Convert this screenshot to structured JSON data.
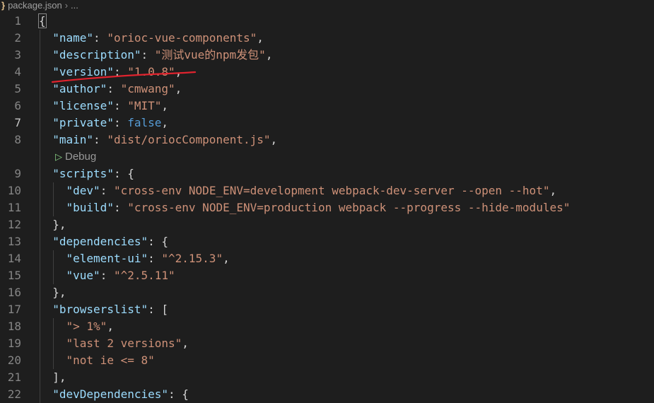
{
  "breadcrumb": {
    "file_icon": "}",
    "file": "package.json",
    "separator": "›",
    "more": "..."
  },
  "codelens": {
    "label": "Debug"
  },
  "colors": {
    "key": "#9cdcfe",
    "string": "#ce9178",
    "keyword": "#569cd6",
    "annotation": "#e0232e"
  },
  "icons": [
    "json-file-icon",
    "play-icon"
  ],
  "lines": [
    {
      "n": "1",
      "indent": 0,
      "tokens": [
        [
          "p",
          "{"
        ]
      ]
    },
    {
      "n": "2",
      "indent": 1,
      "tokens": [
        [
          "k",
          "\"name\""
        ],
        [
          "p",
          ": "
        ],
        [
          "s",
          "\"orioc-vue-components\""
        ],
        [
          "p",
          ","
        ]
      ]
    },
    {
      "n": "3",
      "indent": 1,
      "tokens": [
        [
          "k",
          "\"description\""
        ],
        [
          "p",
          ": "
        ],
        [
          "s",
          "\"测试vue的npm发包\""
        ],
        [
          "p",
          ","
        ]
      ]
    },
    {
      "n": "4",
      "indent": 1,
      "tokens": [
        [
          "k",
          "\"version\""
        ],
        [
          "p",
          ": "
        ],
        [
          "s",
          "\"1.0.8\""
        ],
        [
          "p",
          ","
        ]
      ]
    },
    {
      "n": "5",
      "indent": 1,
      "tokens": [
        [
          "k",
          "\"author\""
        ],
        [
          "p",
          ": "
        ],
        [
          "s",
          "\"cmwang\""
        ],
        [
          "p",
          ","
        ]
      ]
    },
    {
      "n": "6",
      "indent": 1,
      "tokens": [
        [
          "k",
          "\"license\""
        ],
        [
          "p",
          ": "
        ],
        [
          "s",
          "\"MIT\""
        ],
        [
          "p",
          ","
        ]
      ]
    },
    {
      "n": "7",
      "indent": 1,
      "tokens": [
        [
          "k",
          "\"private\""
        ],
        [
          "p",
          ": "
        ],
        [
          "kw",
          "false"
        ],
        [
          "p",
          ","
        ]
      ]
    },
    {
      "n": "8",
      "indent": 1,
      "tokens": [
        [
          "k",
          "\"main\""
        ],
        [
          "p",
          ": "
        ],
        [
          "s",
          "\"dist/oriocComponent.js\""
        ],
        [
          "p",
          ","
        ]
      ]
    },
    {
      "n": "9",
      "indent": 1,
      "tokens": [
        [
          "k",
          "\"scripts\""
        ],
        [
          "p",
          ": {"
        ]
      ]
    },
    {
      "n": "10",
      "indent": 2,
      "tokens": [
        [
          "k",
          "\"dev\""
        ],
        [
          "p",
          ": "
        ],
        [
          "s",
          "\"cross-env NODE_ENV=development webpack-dev-server --open --hot\""
        ],
        [
          "p",
          ","
        ]
      ]
    },
    {
      "n": "11",
      "indent": 2,
      "tokens": [
        [
          "k",
          "\"build\""
        ],
        [
          "p",
          ": "
        ],
        [
          "s",
          "\"cross-env NODE_ENV=production webpack --progress --hide-modules\""
        ]
      ]
    },
    {
      "n": "12",
      "indent": 1,
      "tokens": [
        [
          "p",
          "},"
        ]
      ]
    },
    {
      "n": "13",
      "indent": 1,
      "tokens": [
        [
          "k",
          "\"dependencies\""
        ],
        [
          "p",
          ": {"
        ]
      ]
    },
    {
      "n": "14",
      "indent": 2,
      "tokens": [
        [
          "k",
          "\"element-ui\""
        ],
        [
          "p",
          ": "
        ],
        [
          "s",
          "\"^2.15.3\""
        ],
        [
          "p",
          ","
        ]
      ]
    },
    {
      "n": "15",
      "indent": 2,
      "tokens": [
        [
          "k",
          "\"vue\""
        ],
        [
          "p",
          ": "
        ],
        [
          "s",
          "\"^2.5.11\""
        ]
      ]
    },
    {
      "n": "16",
      "indent": 1,
      "tokens": [
        [
          "p",
          "},"
        ]
      ]
    },
    {
      "n": "17",
      "indent": 1,
      "tokens": [
        [
          "k",
          "\"browserslist\""
        ],
        [
          "p",
          ": ["
        ]
      ]
    },
    {
      "n": "18",
      "indent": 2,
      "tokens": [
        [
          "s",
          "\"> 1%\""
        ],
        [
          "p",
          ","
        ]
      ]
    },
    {
      "n": "19",
      "indent": 2,
      "tokens": [
        [
          "s",
          "\"last 2 versions\""
        ],
        [
          "p",
          ","
        ]
      ]
    },
    {
      "n": "20",
      "indent": 2,
      "tokens": [
        [
          "s",
          "\"not ie <= 8\""
        ]
      ]
    },
    {
      "n": "21",
      "indent": 1,
      "tokens": [
        [
          "p",
          "],"
        ]
      ]
    },
    {
      "n": "22",
      "indent": 1,
      "tokens": [
        [
          "k",
          "\"devDependencies\""
        ],
        [
          "p",
          ": {"
        ]
      ]
    }
  ]
}
